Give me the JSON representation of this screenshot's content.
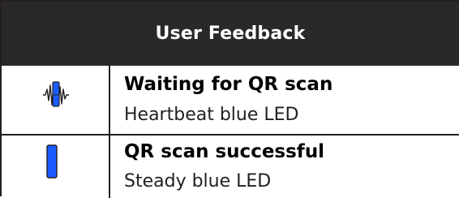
{
  "header": {
    "title": "User Feedback"
  },
  "rows": [
    {
      "icon": "heartbeat-led-icon",
      "status": "Waiting for QR scan",
      "description": "Heartbeat blue LED"
    },
    {
      "icon": "steady-led-icon",
      "status": "QR scan successful",
      "description": "Steady blue LED"
    }
  ],
  "colors": {
    "header_background": "#2a2829",
    "header_text": "#ffffff",
    "led_blue": "#1a5cff",
    "border": "#231f20"
  }
}
